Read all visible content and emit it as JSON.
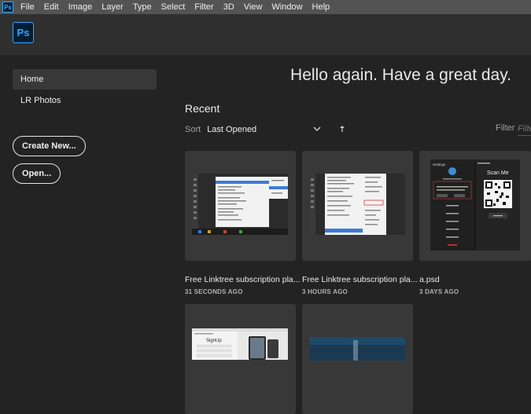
{
  "menubar": {
    "app_icon": "Ps",
    "items": [
      "File",
      "Edit",
      "Image",
      "Layer",
      "Type",
      "Select",
      "Filter",
      "3D",
      "View",
      "Window",
      "Help"
    ]
  },
  "header": {
    "logo": "Ps"
  },
  "sidebar": {
    "items": [
      {
        "label": "Home",
        "active": true
      },
      {
        "label": "LR Photos",
        "active": false
      }
    ],
    "create_new_label": "Create New...",
    "open_label": "Open..."
  },
  "main": {
    "greeting": "Hello again. Have a great day.",
    "recent_title": "Recent",
    "sort_label": "Sort",
    "sort_value": "Last Opened",
    "filter_label": "Filter",
    "filter_placeholder": "Filter Recent Files"
  },
  "recent_files": [
    {
      "name": "Free Linktree subscription pla...",
      "time": "31 SECONDS AGO",
      "thumb_icon": "photoshop-menu-screenshot"
    },
    {
      "name": "Free Linktree subscription pla...",
      "time": "3 HOURS AGO",
      "thumb_icon": "photoshop-menu-screenshot"
    },
    {
      "name": "a.psd",
      "time": "3 DAYS AGO",
      "thumb_icon": "qr-code-settings-screenshot"
    },
    {
      "name": "",
      "time": "",
      "thumb_icon": "signup-page-screenshot"
    },
    {
      "name": "",
      "time": "",
      "thumb_icon": "blue-photo-screenshot"
    }
  ],
  "thumb_text": {
    "scan_me": "Scan Me",
    "settings": "Settings",
    "sign_up": "SignUp"
  },
  "colors": {
    "menubar": "#535353",
    "header": "#2f2f2f",
    "background": "#232323",
    "card": "#383838",
    "accent": "#31a8ff"
  }
}
